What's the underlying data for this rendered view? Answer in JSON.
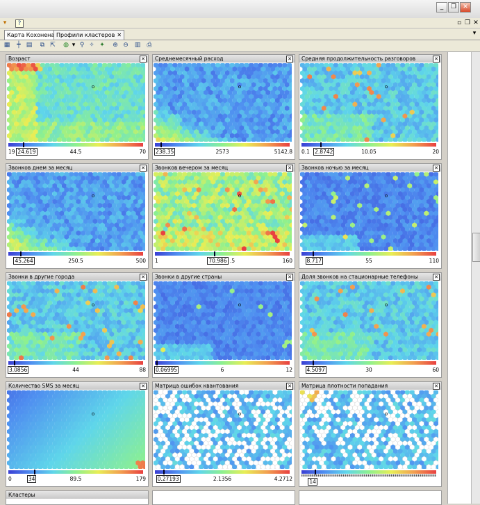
{
  "tabs": [
    {
      "label": "Карта Кохонена"
    },
    {
      "label": "Профили кластеров"
    }
  ],
  "close_glyph": "✕",
  "panels": [
    {
      "title": "Возраст",
      "min": "19",
      "cur": "24.619",
      "mid": "44.5",
      "max": "70",
      "cur_frac": 0.11,
      "seed": 1,
      "profile": "age"
    },
    {
      "title": "Среднемесячный расход",
      "min": "",
      "cur": "238.35",
      "mid": "2573",
      "max": "5142.8",
      "cur_frac": 0.04,
      "seed": 2,
      "profile": "lowleft"
    },
    {
      "title": "Средняя продолжительность разговоров",
      "min": "0.1",
      "cur": "2.8742",
      "mid": "10.05",
      "max": "20",
      "cur_frac": 0.14,
      "seed": 3,
      "profile": "mixed"
    },
    {
      "title": "Звонков днем за месяц",
      "min": "",
      "cur": "45.264",
      "mid": "250.5",
      "max": "500",
      "cur_frac": 0.09,
      "seed": 4,
      "profile": "lowleft"
    },
    {
      "title": "Звонков вечером за месяц",
      "min": "1",
      "cur": "70.986",
      "mid": ".5",
      "max": "160",
      "cur_frac": 0.44,
      "seed": 5,
      "profile": "hot"
    },
    {
      "title": "Звонков ночью за месяц",
      "min": "",
      "cur": "8.717",
      "mid": "55",
      "max": "110",
      "cur_frac": 0.08,
      "seed": 6,
      "profile": "low"
    },
    {
      "title": "Звонки в другие города",
      "min": "",
      "cur": "3.0856",
      "mid": "44",
      "max": "88",
      "cur_frac": 0.04,
      "seed": 7,
      "profile": "mixed"
    },
    {
      "title": "Звонки в другие страны",
      "min": "",
      "cur": "0.06995",
      "mid": "6",
      "max": "12",
      "cur_frac": 0.01,
      "seed": 8,
      "profile": "low"
    },
    {
      "title": "Доля звонков на стационарные телефоны",
      "min": "",
      "cur": "4.5097",
      "mid": "30",
      "max": "60",
      "cur_frac": 0.08,
      "seed": 9,
      "profile": "mixed"
    },
    {
      "title": "Количество SMS за месяц",
      "min": "0",
      "cur": "34",
      "mid": "89.5",
      "max": "179",
      "cur_frac": 0.19,
      "seed": 10,
      "profile": "sms"
    },
    {
      "title": "Матрица ошибок квантования",
      "min": "",
      "cur": "0.27193",
      "mid": "2.1356",
      "max": "4.2712",
      "cur_frac": 0.06,
      "seed": 11,
      "profile": "holes"
    },
    {
      "title": "Матрица плотности попадания",
      "min": "",
      "cur": "14",
      "mid": "",
      "max": "",
      "cur_frac": 0.1,
      "seed": 12,
      "profile": "holes2"
    }
  ],
  "bottom_panel_title": "Кластеры"
}
